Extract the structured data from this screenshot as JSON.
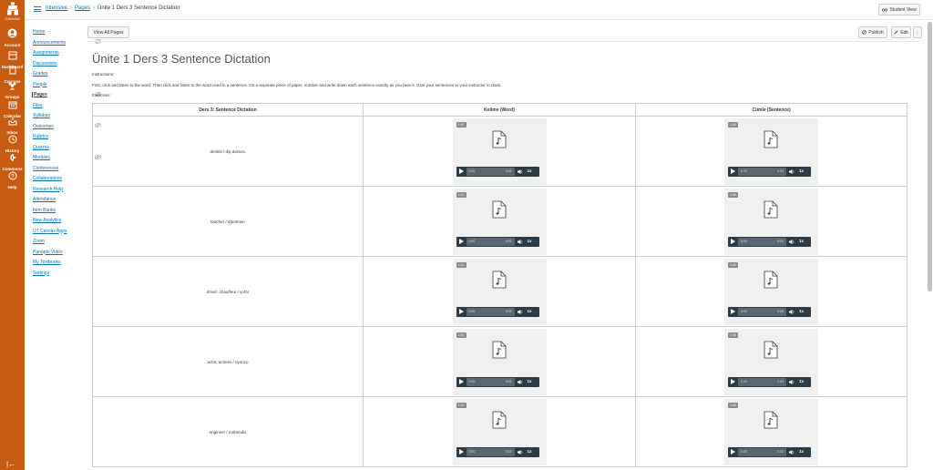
{
  "global_nav": {
    "logo_label": "CANVAS",
    "items": [
      {
        "label": "Account",
        "icon": "account-icon"
      },
      {
        "label": "Dashboard",
        "icon": "dashboard-icon"
      },
      {
        "label": "Courses",
        "icon": "courses-icon"
      },
      {
        "label": "Groups",
        "icon": "groups-icon"
      },
      {
        "label": "Calendar",
        "icon": "calendar-icon"
      },
      {
        "label": "Inbox",
        "icon": "inbox-icon"
      },
      {
        "label": "History",
        "icon": "history-icon"
      },
      {
        "label": "Commons",
        "icon": "commons-icon"
      },
      {
        "label": "Help",
        "icon": "help-icon"
      }
    ],
    "collapse_glyph": "|←"
  },
  "breadcrumb": {
    "items": [
      "Intensive",
      "Pages",
      "Ünite 1 Ders 3 Sentence Dictation"
    ],
    "separator": "›"
  },
  "header": {
    "student_view_label": "Student View"
  },
  "course_nav": {
    "items": [
      {
        "label": "Home",
        "active": false,
        "hidden": false
      },
      {
        "label": "Announcements",
        "active": false,
        "hidden": true
      },
      {
        "label": "Assignments",
        "active": false,
        "hidden": false
      },
      {
        "label": "Discussions",
        "active": false,
        "hidden": false
      },
      {
        "label": "Grades",
        "active": false,
        "hidden": false
      },
      {
        "label": "People",
        "active": false,
        "hidden": false
      },
      {
        "label": "Pages",
        "active": true,
        "hidden": true
      },
      {
        "label": "Files",
        "active": false,
        "hidden": false
      },
      {
        "label": "Syllabus",
        "active": false,
        "hidden": false
      },
      {
        "label": "Outcomes",
        "active": false,
        "hidden": true
      },
      {
        "label": "Rubrics",
        "active": false,
        "hidden": false
      },
      {
        "label": "Quizzes",
        "active": false,
        "hidden": false
      },
      {
        "label": "Modules",
        "active": false,
        "hidden": true
      },
      {
        "label": "Conferences",
        "active": false,
        "hidden": false
      },
      {
        "label": "Collaborations",
        "active": false,
        "hidden": false
      },
      {
        "label": "Research Help",
        "active": false,
        "hidden": false
      },
      {
        "label": "Attendance",
        "active": false,
        "hidden": false
      },
      {
        "label": "Item Banks",
        "active": false,
        "hidden": false
      },
      {
        "label": "New Analytics",
        "active": false,
        "hidden": false
      },
      {
        "label": "UT Canvas Apps",
        "active": false,
        "hidden": false
      },
      {
        "label": "Zoom",
        "active": false,
        "hidden": false
      },
      {
        "label": "Panopto Video",
        "active": false,
        "hidden": false
      },
      {
        "label": "My Textbooks",
        "active": false,
        "hidden": false
      },
      {
        "label": "Settings",
        "active": false,
        "hidden": false
      }
    ]
  },
  "toolbar": {
    "view_all_label": "View All Pages",
    "publish_label": "Publish",
    "edit_label": "Edit",
    "more_label": "⋮"
  },
  "page": {
    "title": "Ünite 1 Ders 3 Sentence Dictation",
    "instructions_heading": "Instructions:",
    "instructions_text": "First, click and listen to the word.  Then click and listen to the word used in a sentence.  On a separate piece of paper, number and write down each sentence exactly as you hear it.  Give your sentences to your instructor in class.",
    "exercises_heading": "Exercises:"
  },
  "table": {
    "headers": [
      "Ders 3: Sentence Dictation",
      "Kelime (Word)",
      "Cümle (Sentence)"
    ],
    "rows": [
      {
        "prompt": "dentist / diş doktoru",
        "word": {
          "duration": "1:40",
          "start": "0:00",
          "end": "0:03",
          "speed": "1x"
        },
        "sentence": {
          "duration": "1:40",
          "start": "0:00",
          "end": "0:04",
          "speed": "1x"
        }
      },
      {
        "prompt": "teacher / öğretmen",
        "word": {
          "duration": "1:40",
          "start": "0:00",
          "end": "0:03",
          "speed": "1x"
        },
        "sentence": {
          "duration": "1:40",
          "start": "0:00",
          "end": "0:04",
          "speed": "1x"
        }
      },
      {
        "prompt": "driver: chauffeur / şoför",
        "word": {
          "duration": "1:40",
          "start": "0:00",
          "end": "0:03",
          "speed": "1x"
        },
        "sentence": {
          "duration": "1:40",
          "start": "0:00",
          "end": "0:03",
          "speed": "1x"
        }
      },
      {
        "prompt": "actor, actress / oyuncu",
        "word": {
          "duration": "1:40",
          "start": "0:00",
          "end": "0:03",
          "speed": "1x"
        },
        "sentence": {
          "duration": "1:40",
          "start": "0:00",
          "end": "0:03",
          "speed": "1x"
        }
      },
      {
        "prompt": "engineer / mühendis",
        "word": {
          "duration": "1:40",
          "start": "0:00",
          "end": "0:03",
          "speed": "1x"
        },
        "sentence": {
          "duration": "1:40",
          "start": "0:00",
          "end": "0:03",
          "speed": "1x"
        }
      }
    ]
  },
  "colors": {
    "brand": "#c75b12",
    "link": "#0374b5",
    "player_bar": "#2d3b45"
  }
}
